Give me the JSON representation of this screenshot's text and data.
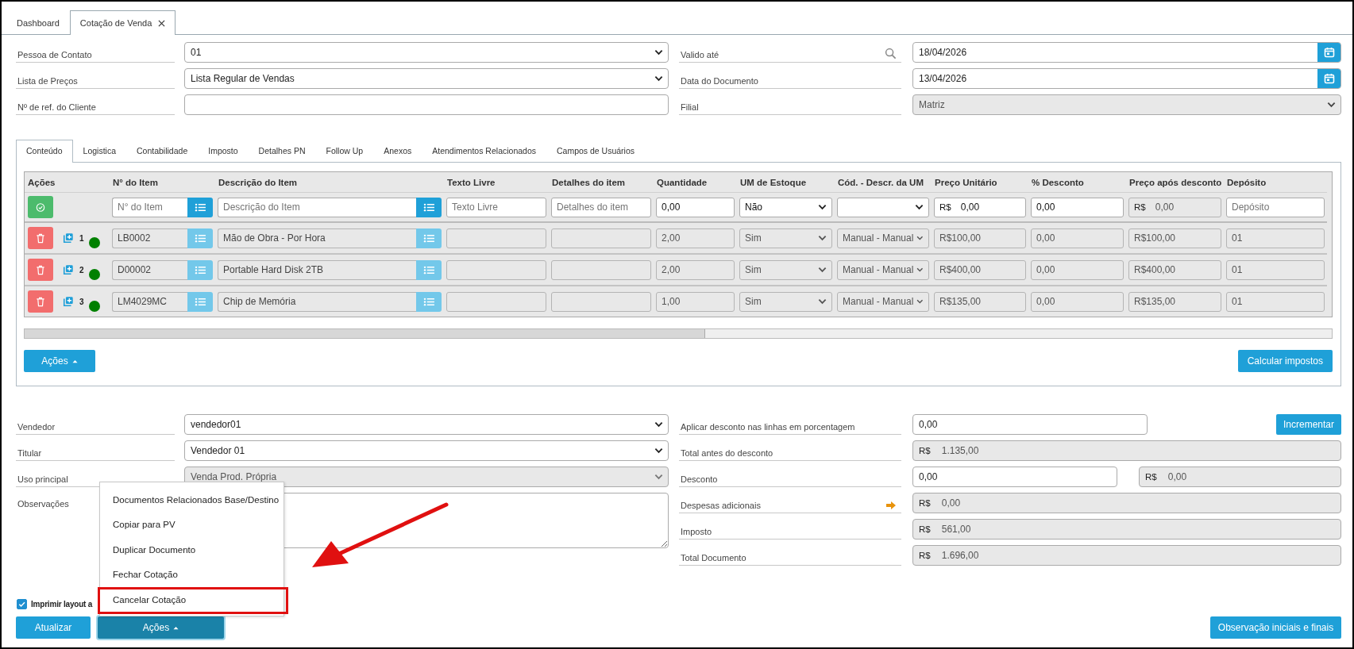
{
  "tabs": [
    {
      "label": "Dashboard",
      "selected": false
    },
    {
      "label": "Cotação de Venda",
      "selected": true,
      "closable": true
    }
  ],
  "header_left": [
    {
      "label": "Pessoa de Contato",
      "kind": "select",
      "value": "01",
      "disabled": false
    },
    {
      "label": "Lista de Preços",
      "kind": "select",
      "value": "Lista Regular de Vendas",
      "disabled": false
    },
    {
      "label": "Nº de ref. do Cliente",
      "kind": "input",
      "disabled": false
    }
  ],
  "header_right": [
    {
      "label": "Valido até",
      "kind": "date",
      "value": "18/04/2026",
      "disabled": false,
      "search": true
    },
    {
      "label": "Data do Documento",
      "kind": "date",
      "value": "13/04/2026",
      "disabled": false
    },
    {
      "label": "Filial",
      "kind": "select",
      "value": "Matriz",
      "disabled": true
    }
  ],
  "section_tabs": [
    {
      "label": "Conteúdo",
      "selected": true
    },
    {
      "label": "Logistica",
      "selected": false
    },
    {
      "label": "Contabilidade",
      "selected": false
    },
    {
      "label": "Imposto",
      "selected": false
    },
    {
      "label": "Detalhes PN",
      "selected": false
    },
    {
      "label": "Follow Up",
      "selected": false
    },
    {
      "label": "Anexos",
      "selected": false
    },
    {
      "label": "Atendimentos Relacionados",
      "selected": false
    },
    {
      "label": "Campos de Usuários",
      "selected": false
    }
  ],
  "table": {
    "columns": [
      "Ações",
      "N° do Item",
      "Descrição do Item",
      "Texto Livre",
      "Detalhes do item",
      "Quantidade",
      "UM de Estoque",
      "Cód. - Descr. da UM",
      "Preço Unitário",
      "% Desconto",
      "Preço após desconto",
      "Depósito"
    ],
    "new_row": {
      "item_placeholder": "N° do Item",
      "description_placeholder": "Descrição do Item",
      "free_text_placeholder": "Texto Livre",
      "details_placeholder": "Detalhes do item",
      "quantity": "0,00",
      "uom": "Não",
      "price_currency": "R$",
      "price": "0,00",
      "discount": "0,00",
      "after_currency": "R$",
      "after": "0,00",
      "warehouse_placeholder": "Depósito"
    },
    "rows": [
      {
        "number": "1",
        "color": "#008000",
        "item": "LB0002",
        "description": "Mão de Obra - Por Hora",
        "quantity": "2,00",
        "uom": "Sim",
        "uom_code": "Manual - Manual",
        "price": "R$100,00",
        "discount": "0,00",
        "after": "R$100,00",
        "warehouse": "01"
      },
      {
        "number": "2",
        "color": "#008000",
        "item": "D00002",
        "description": "Portable Hard Disk 2TB",
        "quantity": "2,00",
        "uom": "Sim",
        "uom_code": "Manual - Manual",
        "price": "R$400,00",
        "discount": "0,00",
        "after": "R$400,00",
        "warehouse": "01"
      },
      {
        "number": "3",
        "color": "#008000",
        "item": "LM4029MC",
        "description": "Chip de Memória",
        "quantity": "1,00",
        "uom": "Sim",
        "uom_code": "Manual - Manual",
        "price": "R$135,00",
        "discount": "0,00",
        "after": "R$135,00",
        "warehouse": "01"
      }
    ]
  },
  "table_actions": "Ações",
  "calc_button": "Calcular impostos",
  "bottom_left": [
    {
      "label": "Vendedor",
      "kind": "select",
      "value": "vendedor01",
      "disabled": false
    },
    {
      "label": "Titular",
      "kind": "select",
      "value": "Vendedor 01",
      "disabled": false
    },
    {
      "label": "Uso principal",
      "kind": "select",
      "value": "Venda Prod. Própria",
      "disabled": true
    },
    {
      "label": "Observações",
      "kind": "textarea"
    }
  ],
  "bottom_right": [
    {
      "label": "Aplicar desconto nas linhas em porcentagem",
      "kind": "input_button",
      "value": "0,00",
      "button": "Incrementar"
    },
    {
      "label": "Total antes do desconto",
      "kind": "money",
      "currency": "R$",
      "value": "1.135,00"
    },
    {
      "label": "Desconto",
      "kind": "input_money",
      "value": "0,00",
      "currency": "R$",
      "amount": "0,00"
    },
    {
      "label": "Despesas adicionais",
      "kind": "money",
      "link": true,
      "currency": "R$",
      "value": "0,00"
    },
    {
      "label": "Imposto",
      "kind": "money",
      "currency": "R$",
      "value": "561,00"
    },
    {
      "label": "Total Documento",
      "kind": "money",
      "currency": "R$",
      "value": "1.696,00"
    }
  ],
  "print_option": {
    "label": "Imprimir layout a",
    "checked": true
  },
  "footer": {
    "refresh": "Atualizar",
    "actions": "Ações",
    "actions_open": true,
    "notes": "Observação iniciais e finais"
  },
  "menu": [
    {
      "label": "Documentos Relacionados Base/Destino",
      "annotated": false
    },
    {
      "label": "Copiar para PV",
      "annotated": false
    },
    {
      "label": "Duplicar Documento",
      "annotated": false
    },
    {
      "label": "Fechar Cotação",
      "annotated": false
    },
    {
      "label": "Cancelar Cotação",
      "annotated": true
    }
  ]
}
